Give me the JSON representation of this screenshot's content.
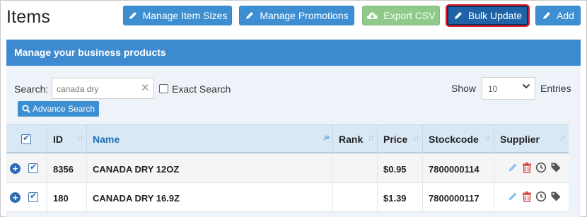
{
  "page": {
    "title": "Items"
  },
  "toolbar": {
    "manage_item_sizes": "Manage Item Sizes",
    "manage_promotions": "Manage Promotions",
    "export_csv": "Export CSV",
    "bulk_update": "Bulk Update",
    "add": "Add"
  },
  "panel": {
    "title": "Manage your business products"
  },
  "search": {
    "label": "Search:",
    "value": "canada dry",
    "exact_label": "Exact Search",
    "exact_checked": false,
    "advance_label": "Advance Search"
  },
  "pagination": {
    "show_label": "Show",
    "selected": "10",
    "entries_label": "Entries"
  },
  "table": {
    "columns": [
      "ID",
      "Name",
      "Rank",
      "Price",
      "Stockcode",
      "Supplier"
    ],
    "rows": [
      {
        "id": "8356",
        "name": "CANADA DRY 12OZ",
        "rank": "",
        "price": "$0.95",
        "stockcode": "7800000114",
        "supplier": ""
      },
      {
        "id": "180",
        "name": "CANADA DRY 16.9Z",
        "rank": "",
        "price": "$1.39",
        "stockcode": "7800000117",
        "supplier": ""
      }
    ]
  },
  "colors": {
    "primary": "#3d8fd1",
    "header_bar": "#3d8ad0",
    "export_green": "#8fca8a",
    "active_outline": "#e41d2a",
    "delete_red": "#d9534f"
  },
  "icons": [
    "pencil-icon",
    "cloud-download-icon",
    "search-icon",
    "chevron-down-icon",
    "sort-icon",
    "expand-plus-icon",
    "edit-icon",
    "trash-icon",
    "clock-icon",
    "tag-icon"
  ]
}
